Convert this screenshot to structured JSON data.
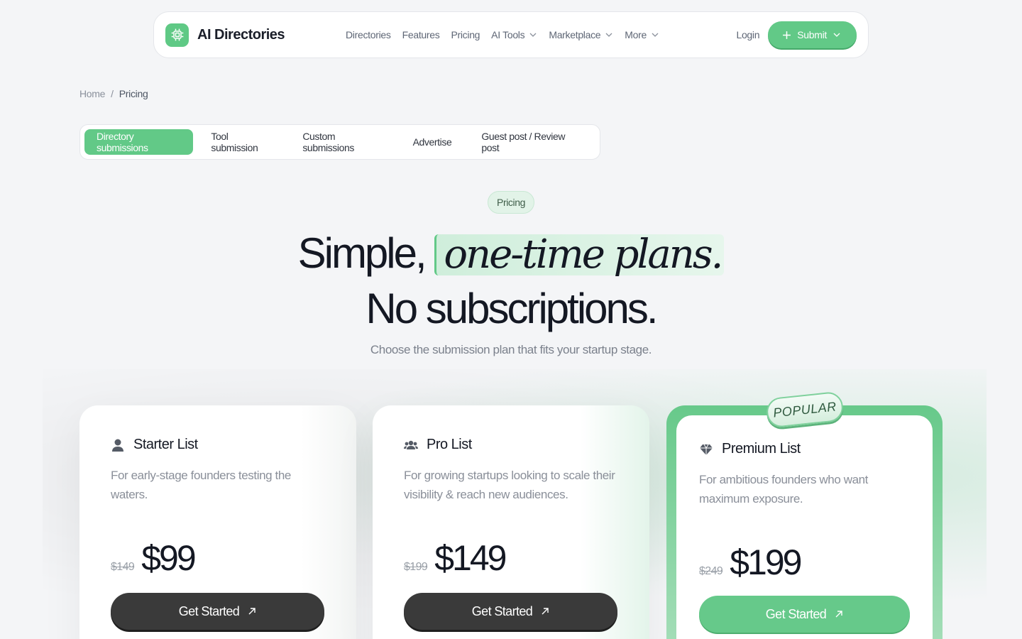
{
  "brand": {
    "name": "AI Directories",
    "logo_icon": "chip-icon",
    "accent": "#62c987"
  },
  "nav": {
    "links": [
      {
        "label": "Directories",
        "has_dropdown": false
      },
      {
        "label": "Features",
        "has_dropdown": false
      },
      {
        "label": "Pricing",
        "has_dropdown": false
      },
      {
        "label": "AI Tools",
        "has_dropdown": true
      },
      {
        "label": "Marketplace",
        "has_dropdown": true
      },
      {
        "label": "More",
        "has_dropdown": true
      }
    ],
    "login": "Login",
    "submit": "Submit"
  },
  "breadcrumb": {
    "home": "Home",
    "separator": "/",
    "current": "Pricing"
  },
  "tabs": [
    {
      "label": "Directory submissions",
      "active": true
    },
    {
      "label": "Tool submission",
      "active": false
    },
    {
      "label": "Custom submissions",
      "active": false
    },
    {
      "label": "Advertise",
      "active": false
    },
    {
      "label": "Guest post / Review post",
      "active": false
    }
  ],
  "hero": {
    "pill": "Pricing",
    "line1_prefix": "Simple,",
    "line1_highlight": "one-time plans.",
    "line2": "No subscriptions.",
    "subtitle": "Choose the submission plan that fits your startup stage."
  },
  "plans": [
    {
      "title": "Starter List",
      "icon": "user-icon",
      "desc": "For early-stage founders testing the waters.",
      "old_price": "$149",
      "price": "$99",
      "cta": "Get Started",
      "popular": false
    },
    {
      "title": "Pro List",
      "icon": "users-icon",
      "desc": "For growing startups looking to scale their visibility & reach new audiences.",
      "old_price": "$199",
      "price": "$149",
      "cta": "Get Started",
      "popular": false
    },
    {
      "title": "Premium List",
      "icon": "diamond-icon",
      "desc": "For ambitious founders who want maximum exposure.",
      "old_price": "$249",
      "price": "$199",
      "cta": "Get Started",
      "popular": true,
      "badge": "POPULAR"
    }
  ]
}
